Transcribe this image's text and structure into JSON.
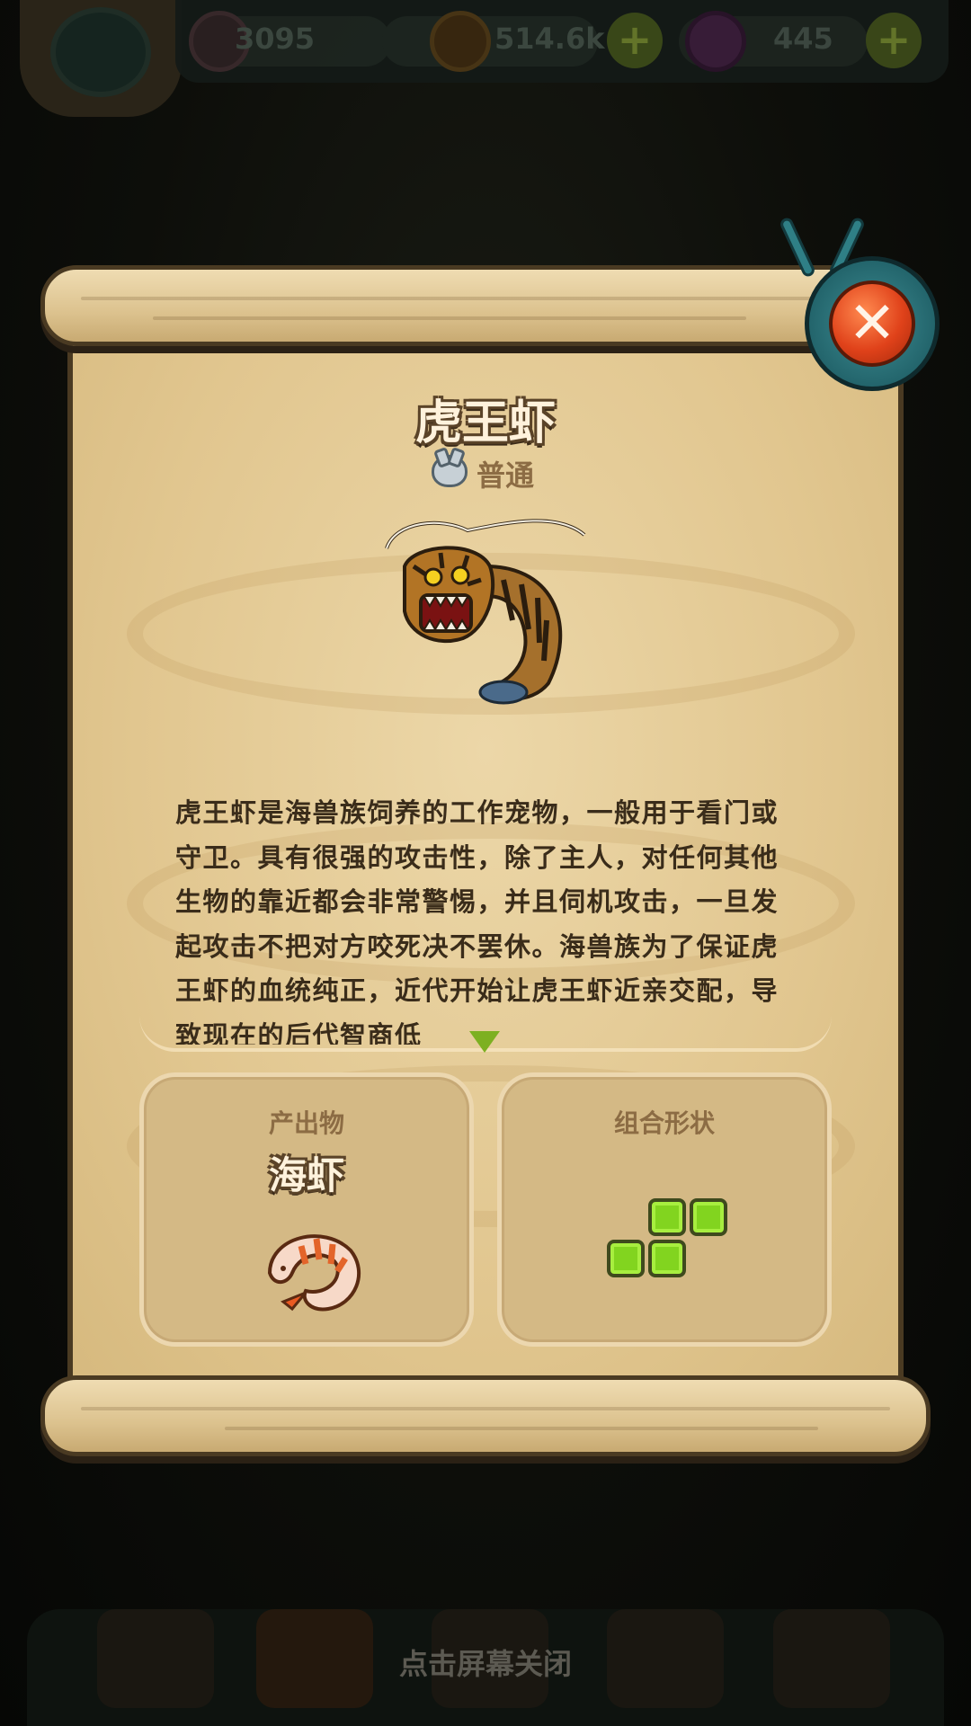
{
  "top_bar": {
    "gems": "3095",
    "coins": "514.6k",
    "potions": "445",
    "add_coins_label": "+",
    "add_potions_label": "+"
  },
  "popup": {
    "title": "虎王虾",
    "rarity": "普通",
    "description": "虎王虾是海兽族饲养的工作宠物，一般用于看门或守卫。具有很强的攻击性，除了主人，对任何其他生物的靠近都会非常警惕，并且伺机攻击，一旦发起攻击不把对方咬死决不罢休。海兽族为了保证虎王虾的血统纯正，近代开始让虎王虾近亲交配，导致现在的后代智商低",
    "close_glyph": "✕",
    "output_panel": {
      "label": "产出物",
      "item_name": "海虾"
    },
    "shape_panel": {
      "label": "组合形状"
    }
  },
  "footer": {
    "tap_to_close": "点击屏幕关闭"
  },
  "colors": {
    "title_fill": "#fff2dc",
    "title_outline": "#5a4328",
    "shape_cell": "#82d41f",
    "close_button": "#e0421a"
  }
}
